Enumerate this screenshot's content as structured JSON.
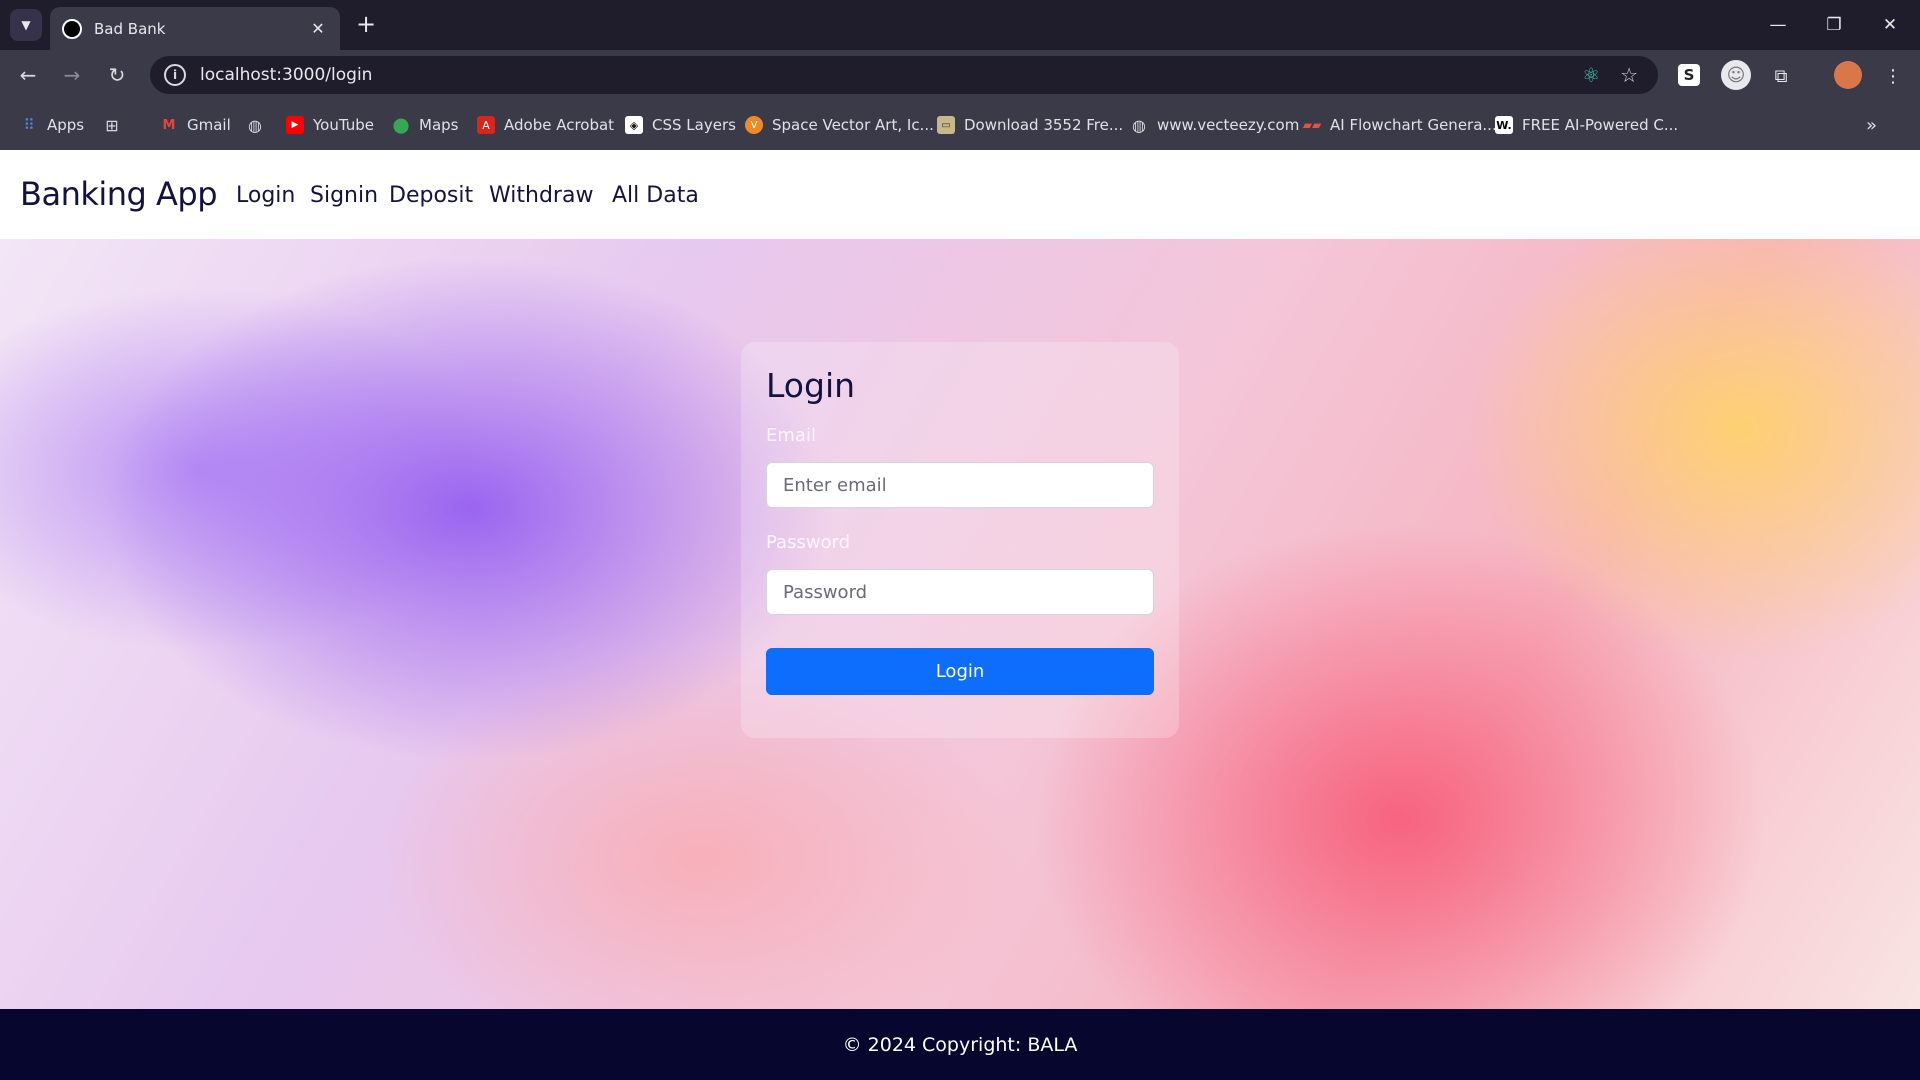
{
  "browser": {
    "tab_title": "Bad Bank",
    "url": "localhost:3000/login",
    "bookmarks": [
      {
        "label": "Apps",
        "icon": "apps-grid-icon"
      },
      {
        "label": "Gmail",
        "icon": "gmail-icon"
      },
      {
        "label": "YouTube",
        "icon": "youtube-icon"
      },
      {
        "label": "Maps",
        "icon": "maps-icon"
      },
      {
        "label": "Adobe Acrobat",
        "icon": "acrobat-icon"
      },
      {
        "label": "CSS Layers",
        "icon": "css-layers-icon"
      },
      {
        "label": "Space Vector Art, Ic...",
        "icon": "vector-art-icon"
      },
      {
        "label": "Download 3552 Fre...",
        "icon": "download-icon"
      },
      {
        "label": "www.vecteezy.com",
        "icon": "globe-icon"
      },
      {
        "label": "AI Flowchart Genera...",
        "icon": "flowchart-icon"
      },
      {
        "label": "FREE AI-Powered C...",
        "icon": "w-icon"
      }
    ]
  },
  "app": {
    "brand": "Banking App",
    "nav": [
      "Login",
      "Signin",
      "Deposit",
      "Withdraw",
      "All Data"
    ]
  },
  "login": {
    "title": "Login",
    "email_label": "Email",
    "email_placeholder": "Enter email",
    "password_label": "Password",
    "password_placeholder": "Password",
    "submit_label": "Login"
  },
  "footer": {
    "text": "© 2024 Copyright: BALA"
  },
  "colors": {
    "primary": "#0d6efd",
    "footer_bg": "#06062e",
    "brand_text": "#14133f"
  }
}
